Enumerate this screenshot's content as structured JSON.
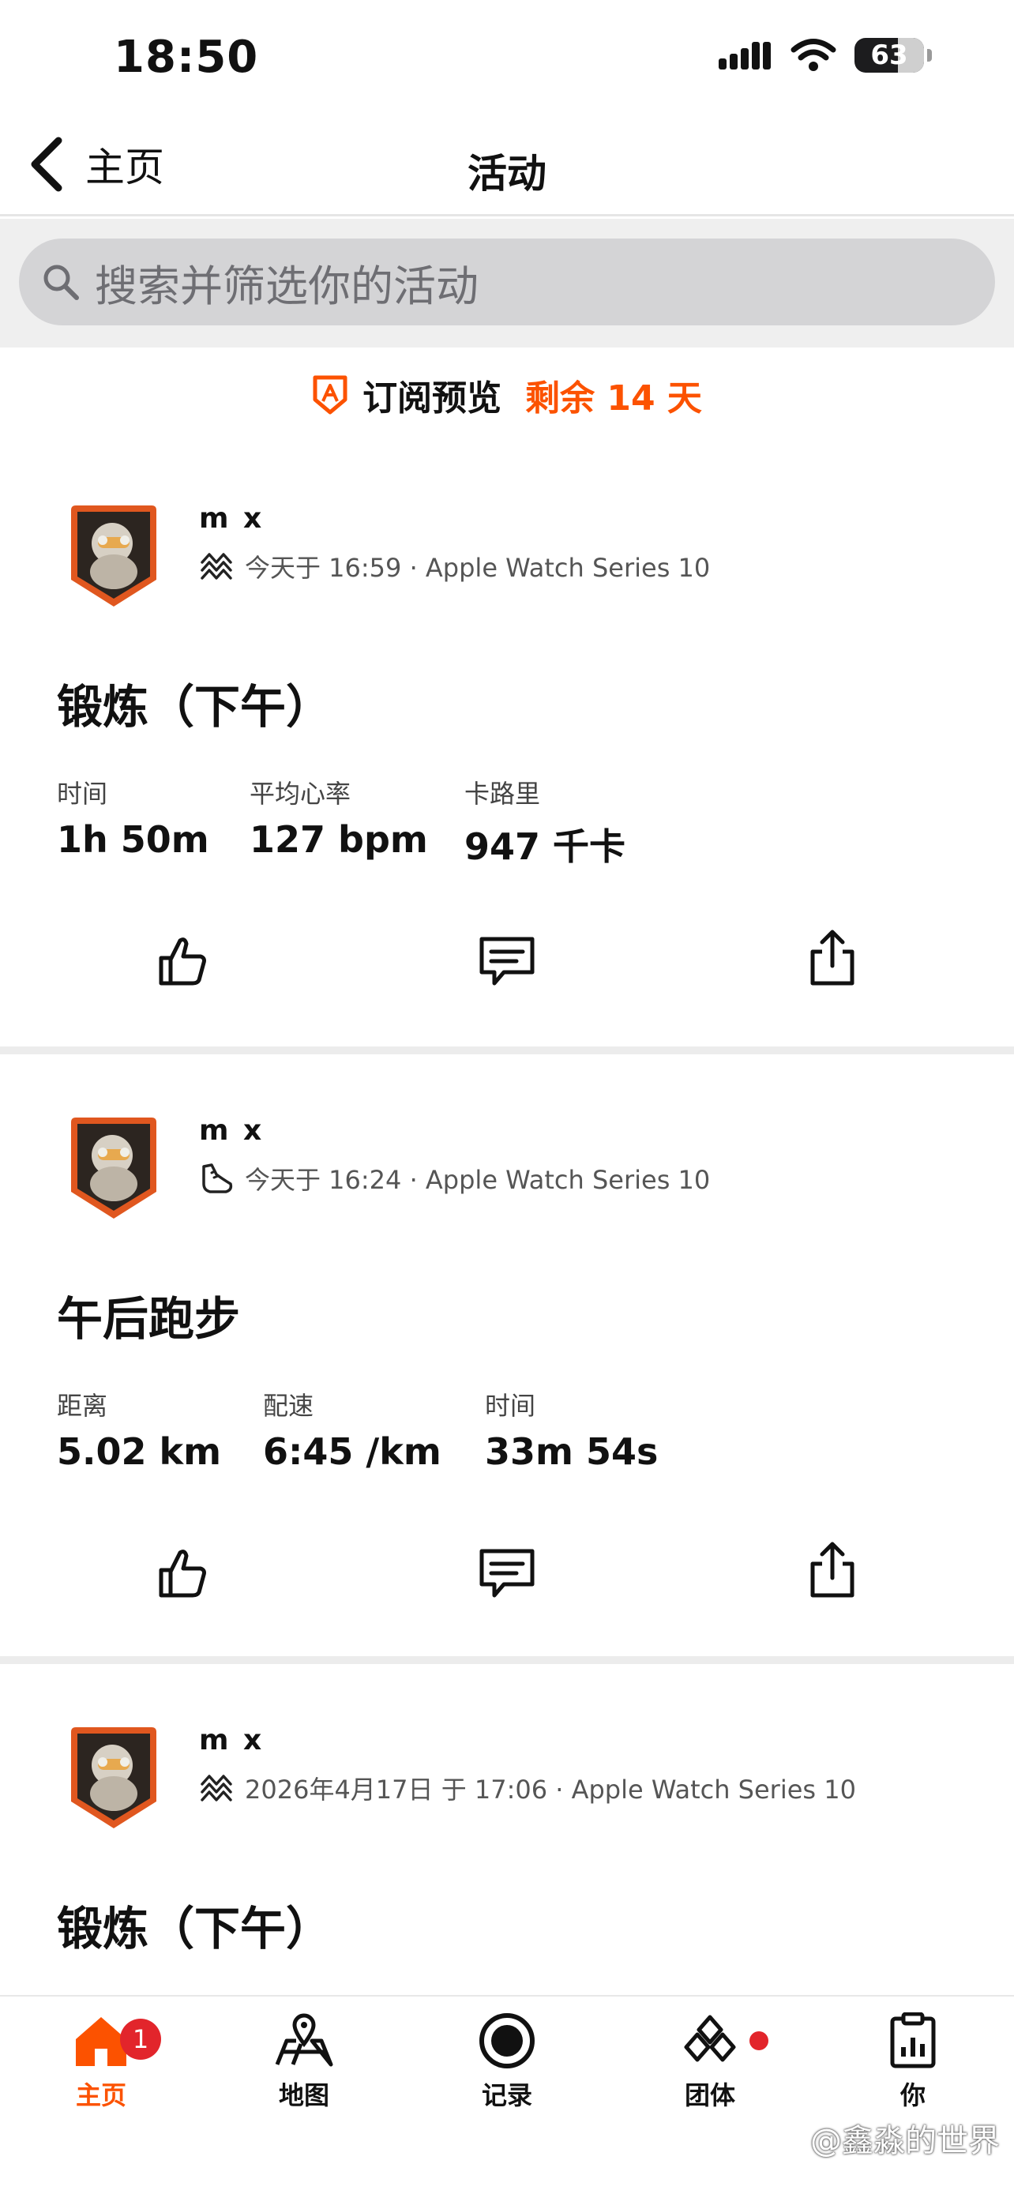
{
  "status_bar": {
    "time": "18:50",
    "battery": "63",
    "battery_level": 0.63
  },
  "nav": {
    "back_label": "主页",
    "title": "活动"
  },
  "search": {
    "placeholder": "搜索并筛选你的活动"
  },
  "subscription": {
    "label": "订阅预览",
    "remaining": "剩余 14 天"
  },
  "feed": [
    {
      "athlete": "m x",
      "sport_icon": "workout-icon",
      "meta": "今天于 16:59 · Apple Watch Series 10",
      "title": "锻炼（下午）",
      "stats": [
        {
          "label": "时间",
          "value": "1h 50m"
        },
        {
          "label": "平均心率",
          "value": "127 bpm"
        },
        {
          "label": "卡路里",
          "value": "947 千卡"
        }
      ]
    },
    {
      "athlete": "m x",
      "sport_icon": "run-shoe-icon",
      "meta": "今天于 16:24 · Apple Watch Series 10",
      "title": "午后跑步",
      "stats": [
        {
          "label": "距离",
          "value": "5.02 km"
        },
        {
          "label": "配速",
          "value": "6:45 /km"
        },
        {
          "label": "时间",
          "value": "33m 54s"
        }
      ]
    },
    {
      "athlete": "m x",
      "sport_icon": "workout-icon",
      "meta": "2026年4月17日 于 17:06 · Apple Watch Series 10",
      "title": "锻炼（下午）"
    }
  ],
  "tabs": [
    {
      "label": "主页",
      "icon": "home-icon",
      "active": true,
      "badge": "1"
    },
    {
      "label": "地图",
      "icon": "map-icon"
    },
    {
      "label": "记录",
      "icon": "record-icon"
    },
    {
      "label": "团体",
      "icon": "groups-icon",
      "dot": true
    },
    {
      "label": "你",
      "icon": "profile-icon"
    }
  ],
  "watermark": "@鑫淼的世界",
  "colors": {
    "accent": "#fc5200",
    "badge": "#e2252b"
  }
}
